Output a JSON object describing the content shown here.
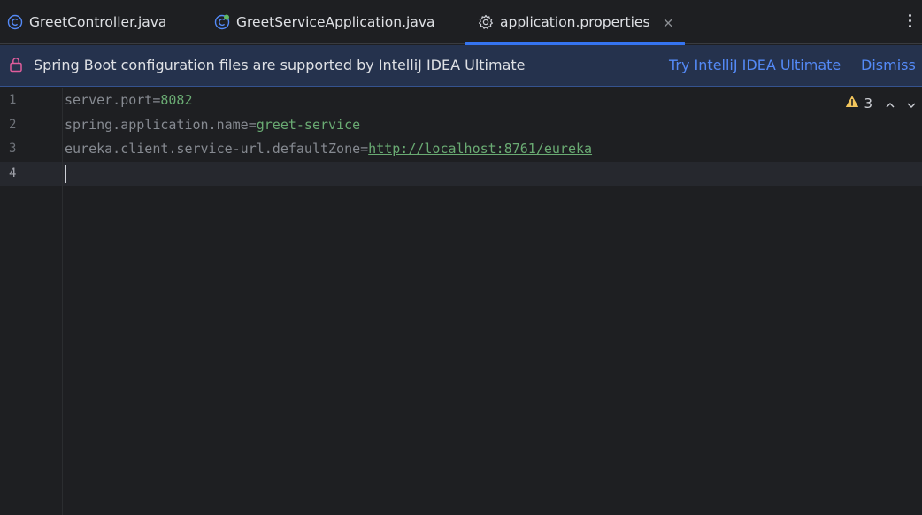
{
  "tabs": [
    {
      "label": "GreetController.java",
      "icon": "class-icon"
    },
    {
      "label": "GreetServiceApplication.java",
      "icon": "spring-boot-class-icon"
    },
    {
      "label": "application.properties",
      "icon": "gear-icon",
      "active": true,
      "close": "×"
    }
  ],
  "banner": {
    "message": "Spring Boot configuration files are supported by IntelliJ IDEA Ultimate",
    "try_label": "Try IntelliJ IDEA Ultimate",
    "dismiss_label": "Dismiss"
  },
  "editor": {
    "lines": [
      {
        "number": "1",
        "key": "server.port",
        "eq": "=",
        "value": "8082"
      },
      {
        "number": "2",
        "key": "spring.application.name",
        "eq": "=",
        "value": "greet-service"
      },
      {
        "number": "3",
        "key": "eureka.client.service-url.defaultZone",
        "eq": "=",
        "value": "http://localhost:8761/eureka"
      },
      {
        "number": "4",
        "key": "",
        "eq": "",
        "value": ""
      }
    ],
    "warnings_count": "3"
  },
  "colors": {
    "accent": "#3574f0",
    "link": "#548af7",
    "value": "#6aab73",
    "warning": "#f2c55c"
  }
}
